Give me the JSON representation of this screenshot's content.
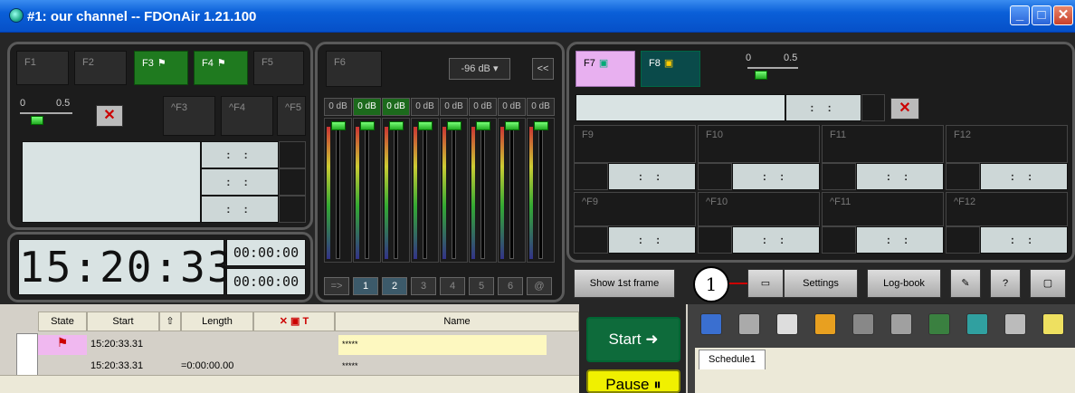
{
  "window": {
    "title": "#1: our channel -- FDOnAir 1.21.100",
    "min": "_",
    "max": "□",
    "close": "✕"
  },
  "panel1": {
    "keys": [
      "F1",
      "F2",
      "F3",
      "F4",
      "F5"
    ],
    "shift_keys": [
      "^F3",
      "^F4",
      "^F5"
    ],
    "slider": {
      "min_label": "0",
      "max_label": "0.5",
      "value": 0.1
    },
    "tc_rows": [
      ": :",
      ": :",
      ": :"
    ]
  },
  "clock": {
    "time": "15:20:33",
    "tc1": "00:00:00",
    "tc2": "00:00:00"
  },
  "mixer": {
    "f6": "F6",
    "db_select": "-96 dB",
    "collapse": "<<",
    "db_labels": [
      "0 dB",
      "0 dB",
      "0 dB",
      "0 dB",
      "0 dB",
      "0 dB",
      "0 dB",
      "0 dB"
    ],
    "db_active": [
      false,
      true,
      true,
      false,
      false,
      false,
      false,
      false
    ],
    "channels": [
      "=>",
      "1",
      "2",
      "3",
      "4",
      "5",
      "6",
      "@"
    ],
    "channels_active": [
      false,
      true,
      true,
      false,
      false,
      false,
      false,
      false
    ]
  },
  "panel3": {
    "f7": "F7",
    "f8": "F8",
    "slider": {
      "min_label": "0",
      "max_label": "0.5",
      "value": 0.2
    },
    "top_tc": ": :",
    "fkeys": [
      "F9",
      "F10",
      "F11",
      "F12"
    ],
    "shift_fkeys": [
      "^F9",
      "^F10",
      "^F11",
      "^F12"
    ],
    "tc": ": :"
  },
  "toolbar": {
    "show_first_frame": "Show 1st frame",
    "callout": "1",
    "settings": "Settings",
    "logbook": "Log-book"
  },
  "playlist": {
    "headers": {
      "state": "State",
      "start": "Start",
      "length": "Length",
      "name": "Name"
    },
    "rows": [
      {
        "start": "15:20:33.31",
        "length": "",
        "name": "*****"
      },
      {
        "start": "15:20:33.31",
        "length": "=0:00:00.00",
        "name": "*****"
      }
    ]
  },
  "transport": {
    "start": "Start",
    "pause": "Pause"
  },
  "schedule": {
    "tab": "Schedule1"
  }
}
